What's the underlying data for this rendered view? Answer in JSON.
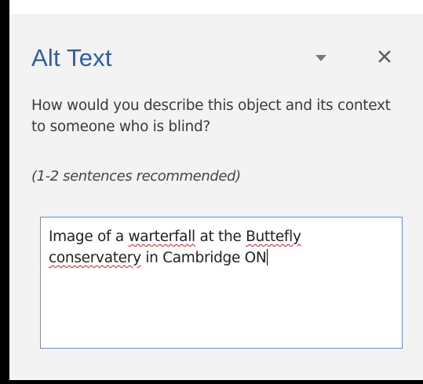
{
  "pane": {
    "title": "Alt Text",
    "description": "How would you describe this object and its context to someone who is blind?",
    "recommendation": "(1-2 sentences recommended)",
    "dropdown_icon": "chevron-down-icon",
    "close_icon": "close-icon",
    "close_symbol": "✕"
  },
  "alt_text_input": {
    "segments": [
      {
        "text": "Image of a ",
        "misspelled": false
      },
      {
        "text": "warterfall",
        "misspelled": true
      },
      {
        "text": " at the ",
        "misspelled": false
      },
      {
        "text": "Buttefly",
        "misspelled": true
      },
      {
        "text": " ",
        "misspelled": false
      },
      {
        "text": "conservatery",
        "misspelled": true
      },
      {
        "text": " in Cambridge ON",
        "misspelled": false
      }
    ]
  },
  "colors": {
    "title": "#2e5fa3",
    "input_border": "#6d8dc6",
    "spellcheck": "#d22020",
    "pane_background": "#f3f3f3"
  }
}
